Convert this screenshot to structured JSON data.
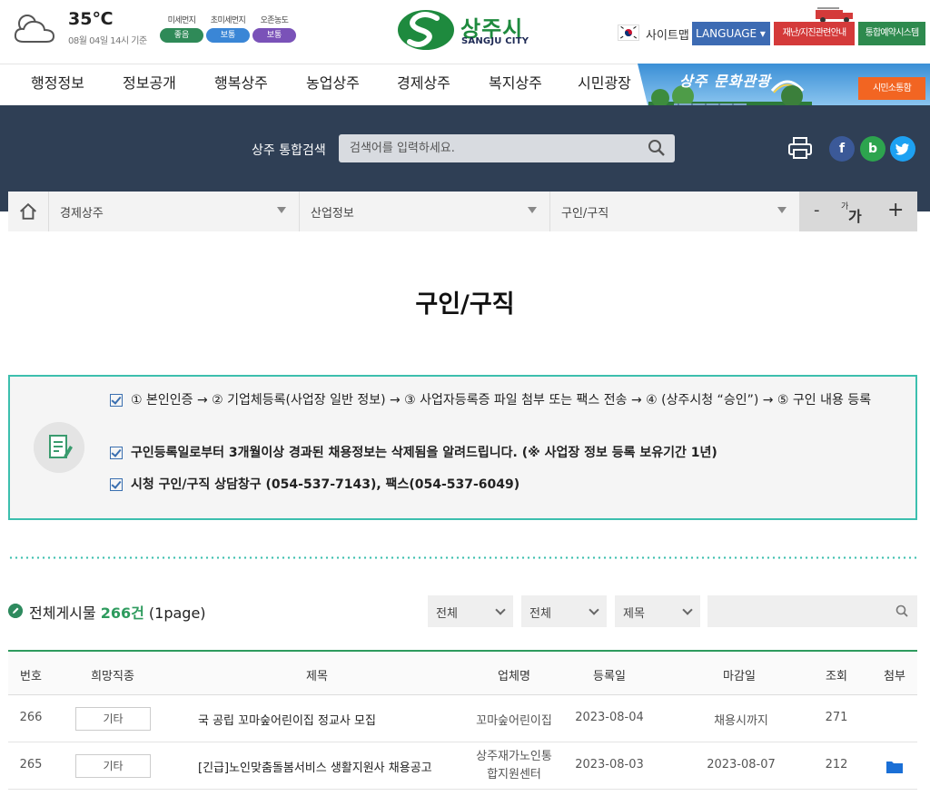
{
  "weather": {
    "temp": "35℃",
    "date": "08월 04일 14시 기준",
    "items": [
      {
        "label": "미세먼지",
        "status": "좋음",
        "color": "#2f8a58"
      },
      {
        "label": "초미세먼지",
        "status": "보통",
        "color": "#3a86d6"
      },
      {
        "label": "오존농도",
        "status": "보통",
        "color": "#7a52b8"
      }
    ]
  },
  "logo": {
    "name": "상주시",
    "sub": "SANGJU CITY"
  },
  "util": {
    "sitemap": "사이트맵",
    "language": "LANGUAGE ▾",
    "disaster": "재난/지진관련안내",
    "reserve": "통합예약시스템"
  },
  "nav": {
    "items": [
      "행정정보",
      "정보공개",
      "행복상주",
      "농업상주",
      "경제상주",
      "복지상주",
      "시민광장"
    ],
    "banner_text": "상주 문화관광",
    "civic": "시민소통함"
  },
  "search": {
    "label": "상주 통합검색",
    "placeholder": "검색어를 입력하세요."
  },
  "breadcrumb": {
    "items": [
      "경제상주",
      "산업정보",
      "구인/구직"
    ],
    "font_minus": "-",
    "font_small": "가",
    "font_big": "가",
    "font_plus": "+"
  },
  "page_title": "구인/구직",
  "notice": {
    "lines": [
      "① 본인인증 → ② 기업체등록(사업장 일반 정보) → ③ 사업자등록증 파일 첨부 또는 팩스 전송 → ④ (상주시청 “승인”) → ⑤ 구인 내용 등록",
      "구인등록일로부터 3개월이상 경과된 채용정보는 삭제됨을 알려드립니다. (※ 사업장 정보 등록 보유기간 1년)",
      "시청 구인/구직 상담창구 (054-537-7143), 팩스(054-537-6049)"
    ]
  },
  "board": {
    "count_prefix": "전체게시물 ",
    "count": "266건",
    "count_suffix": " (1page)",
    "filters": [
      "전체",
      "전체",
      "제목"
    ],
    "columns": [
      "번호",
      "희망직종",
      "제목",
      "업체명",
      "등록일",
      "마감일",
      "조회",
      "첨부"
    ],
    "rows": [
      {
        "no": "266",
        "job": "기타",
        "title": "국 공립 꼬마숲어린이집 정교사 모집",
        "company": "꼬마숲어린이집",
        "company2": "",
        "reg": "2023-08-04",
        "deadline": "채용시까지",
        "views": "271",
        "attach": false
      },
      {
        "no": "265",
        "job": "기타",
        "title": "[긴급]노인맞춤돌봄서비스 생활지원사 채용공고",
        "company": "상주재가노인통",
        "company2": "합지원센터",
        "reg": "2023-08-03",
        "deadline": "2023-08-07",
        "views": "212",
        "attach": true
      }
    ]
  },
  "colors": {
    "header_band": "#2f3f55",
    "accent_green": "#2e9b5e",
    "teal_border": "#3cbfae",
    "lang_blue": "#3d6bb3"
  },
  "icons": [
    "cloud-icon",
    "search-icon",
    "print-icon",
    "facebook-icon",
    "blog-icon",
    "twitter-icon",
    "home-icon",
    "memo-icon",
    "folder-icon"
  ]
}
